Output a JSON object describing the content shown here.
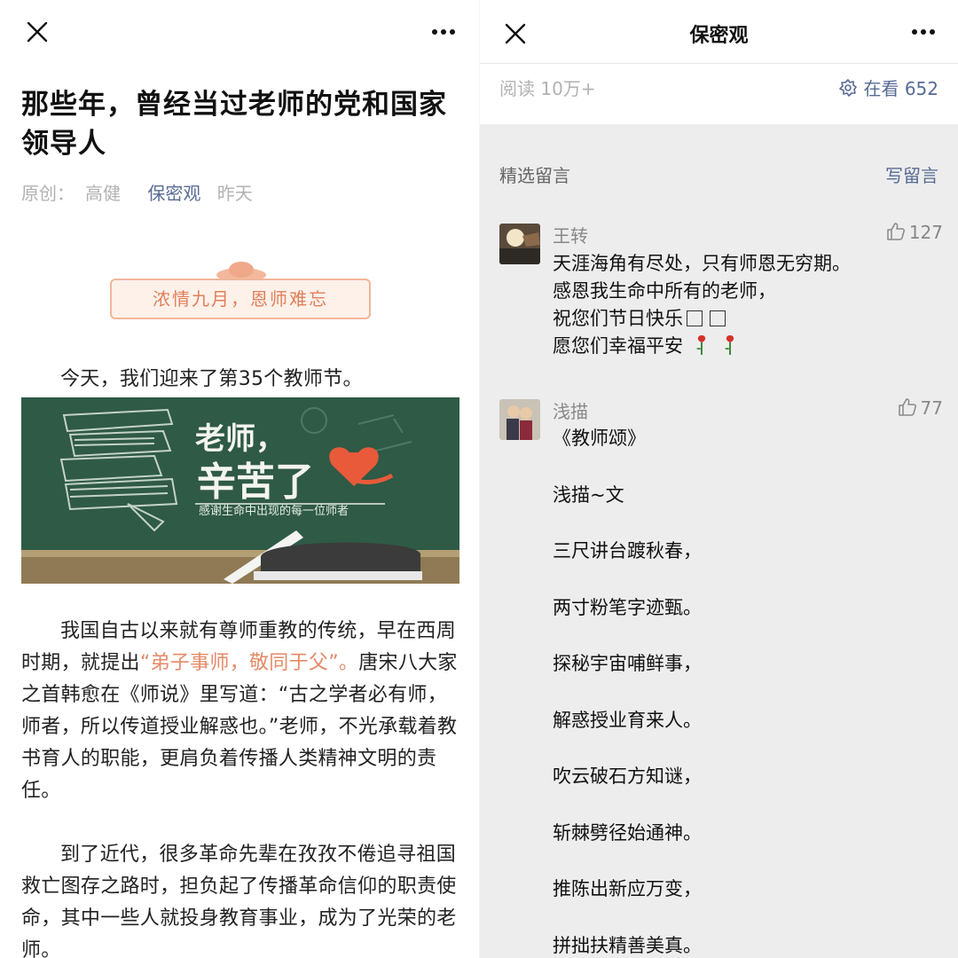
{
  "article": {
    "title": "那些年，曾经当过老师的党和国家领导人",
    "meta": {
      "original": "原创：",
      "author": "高健",
      "account": "保密观",
      "time": "昨天"
    },
    "banner": "浓情九月，恩师难忘",
    "intro": "今天，我们迎来了第35个教师节。",
    "image": {
      "line1": "老师，",
      "line2": "辛苦了",
      "caption": "感谢生命中出现的每一位师者"
    },
    "para1_before": "我国自古以来就有尊师重教的传统，早在西周时期，就提出",
    "para1_quote": "“弟子事师，敬同于父”。",
    "para1_after": "唐宋八大家之首韩愈在《师说》里写道：“古之学者必有师，师者，所以传道授业解惑也。”老师，不光承载着教书育人的职能，更肩负着传播人类精神文明的责任。",
    "para2": "到了近代，很多革命先辈在孜孜不倦追寻祖国救亡图存之路时，担负起了传播革命信仰的职责使命，其中一些人就投身教育事业，成为了光荣的老师。"
  },
  "comments_page": {
    "title": "保密观",
    "read_count": "阅读 10万+",
    "looking": "在看 652",
    "selected_label": "精选留言",
    "write_label": "写留言",
    "comments": [
      {
        "name": "王转",
        "likes": "127",
        "lines": [
          "天涯海角有尽处，只有师恩无穷期。",
          "感恩我生命中所有的老师，",
          "祝您们节日快乐",
          "愿您们幸福平安"
        ]
      },
      {
        "name": "浅描",
        "likes": "77",
        "lines": [
          "《教师颂》",
          "浅描~文",
          "三尺讲台踱秋春，",
          "两寸粉笔字迹甄。",
          "探秘宇宙哺鲜事，",
          "解惑授业育来人。",
          "吹云破石方知谜，",
          "斩棘劈径始通神。",
          "推陈出新应万变，",
          "拼拙扶精善美真。"
        ]
      }
    ]
  },
  "colors": {
    "link": "#576b95",
    "accent": "#e48a67",
    "board": "#2f5a45"
  },
  "icons": [
    "close-icon",
    "more-icon",
    "looking-icon",
    "thumbs-up-icon",
    "rose-icon"
  ]
}
